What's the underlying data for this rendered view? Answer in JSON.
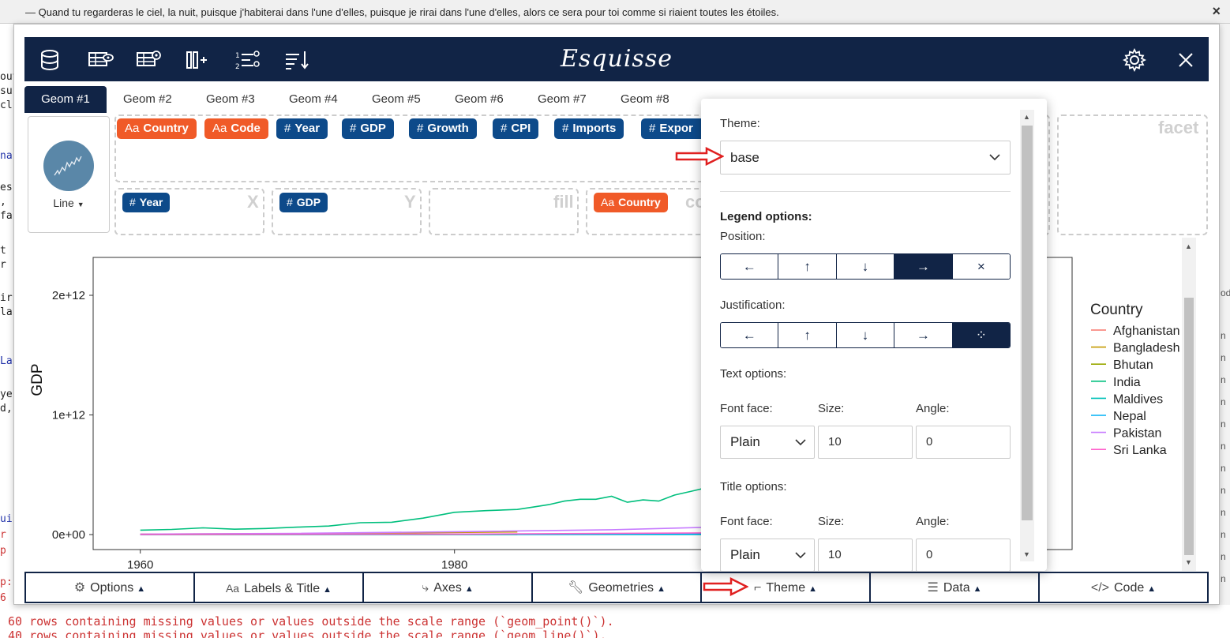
{
  "notification": {
    "message": "— Quand tu regarderas le ciel, la nuit, puisque j'habiterai dans l'une d'elles, puisque je rirai dans l'une d'elles, alors ce sera pour toi comme si riaient toutes les étoiles.",
    "close": "×"
  },
  "app": {
    "title": "Esquisse"
  },
  "tabs": [
    "Geom #1",
    "Geom #2",
    "Geom #3",
    "Geom #4",
    "Geom #5",
    "Geom #6",
    "Geom #7",
    "Geom #8"
  ],
  "geom": {
    "label": "Line"
  },
  "variables": [
    {
      "prefix": "Aa",
      "name": "Country",
      "type": "chr"
    },
    {
      "prefix": "Aa",
      "name": "Code",
      "type": "chr"
    },
    {
      "prefix": "#",
      "name": "Year",
      "type": "num"
    },
    {
      "prefix": "#",
      "name": "GDP",
      "type": "num"
    },
    {
      "prefix": "#",
      "name": "Growth",
      "type": "num"
    },
    {
      "prefix": "#",
      "name": "CPI",
      "type": "num"
    },
    {
      "prefix": "#",
      "name": "Imports",
      "type": "num"
    },
    {
      "prefix": "#",
      "name": "Expor",
      "type": "num"
    }
  ],
  "mappings": {
    "x": {
      "label": "X",
      "chip_prefix": "#",
      "chip": "Year"
    },
    "y": {
      "label": "Y",
      "chip_prefix": "#",
      "chip": "GDP"
    },
    "fill": {
      "label": "fill"
    },
    "color": {
      "label": "co",
      "chip_prefix": "Aa",
      "chip": "Country"
    },
    "facet": {
      "label": "facet"
    }
  },
  "theme_panel": {
    "theme_label": "Theme:",
    "theme_value": "base",
    "legend_heading": "Legend options:",
    "position_label": "Position:",
    "position_buttons": [
      "←",
      "↑",
      "↓",
      "→",
      "×"
    ],
    "position_selected": 3,
    "justification_label": "Justification:",
    "justification_buttons": [
      "←",
      "↑",
      "↓",
      "→",
      "⁘"
    ],
    "justification_selected": 4,
    "text_options_label": "Text options:",
    "font_face_label": "Font face:",
    "size_label": "Size:",
    "angle_label": "Angle:",
    "text_font_face": "Plain",
    "text_size": "10",
    "text_angle": "0",
    "title_options_label": "Title options:",
    "title_font_face": "Plain",
    "title_size": "10",
    "title_angle": "0"
  },
  "bottom_bar": [
    "Options",
    "Labels & Title",
    "Axes",
    "Geometries",
    "Theme",
    "Data",
    "Code"
  ],
  "chart_data": {
    "type": "line",
    "xlabel": "Year",
    "ylabel": "GDP",
    "x_ticks": [
      "1960",
      "1980"
    ],
    "y_ticks": [
      "0e+00",
      "1e+12",
      "2e+12"
    ],
    "legend_title": "Country",
    "legend_position": "right",
    "series": [
      {
        "name": "Afghanistan",
        "color": "#f8766d",
        "x": [
          1960,
          1970,
          1980,
          1984
        ],
        "y": [
          500000000.0,
          1000000000.0,
          3500000000.0,
          4000000000.0
        ]
      },
      {
        "name": "Bangladesh",
        "color": "#c49a00",
        "x": [
          1960,
          1970,
          1980,
          1984
        ],
        "y": [
          4000000000.0,
          8000000000.0,
          18000000000.0,
          22000000000.0
        ]
      },
      {
        "name": "Bhutan",
        "color": "#99a800",
        "x": [
          1960,
          1980,
          1984
        ],
        "y": [
          100000000.0,
          200000000.0,
          300000000.0
        ]
      },
      {
        "name": "India",
        "color": "#00bf7d",
        "x": [
          1960,
          1962,
          1964,
          1966,
          1968,
          1970,
          1972,
          1974,
          1976,
          1978,
          1980,
          1982,
          1984,
          1985,
          1986,
          1987,
          1988,
          1989,
          1990,
          1991,
          1992,
          1993,
          1994,
          1995,
          1996,
          1997,
          1998,
          1999,
          2000
        ],
        "y": [
          37000000000.0,
          43000000000.0,
          56000000000.0,
          45000000000.0,
          51000000000.0,
          62000000000.0,
          71000000000.0,
          99000000000.0,
          103000000000.0,
          137000000000.0,
          186000000000.0,
          200000000000.0,
          210000000000.0,
          230000000000.0,
          250000000000.0,
          280000000000.0,
          295000000000.0,
          295000000000.0,
          320000000000.0,
          270000000000.0,
          290000000000.0,
          280000000000.0,
          330000000000.0,
          360000000000.0,
          390000000000.0,
          415000000000.0,
          420000000000.0,
          460000000000.0,
          470000000000.0
        ]
      },
      {
        "name": "Maldives",
        "color": "#00c0b8",
        "x": [
          1960,
          1980,
          2000
        ],
        "y": [
          50000000.0,
          100000000.0,
          700000000.0
        ]
      },
      {
        "name": "Nepal",
        "color": "#00b0f6",
        "x": [
          1960,
          1980,
          2000
        ],
        "y": [
          500000000.0,
          1900000000.0,
          5500000000.0
        ]
      },
      {
        "name": "Pakistan",
        "color": "#c77cff",
        "x": [
          1960,
          1970,
          1980,
          1990,
          2000
        ],
        "y": [
          3700000000.0,
          10000000000.0,
          24000000000.0,
          40000000000.0,
          74000000000.0
        ]
      },
      {
        "name": "Sri Lanka",
        "color": "#ff61cc",
        "x": [
          1960,
          1980,
          2000
        ],
        "y": [
          1400000000.0,
          4000000000.0,
          16000000000.0
        ]
      }
    ],
    "xlim": [
      1957,
      2000
    ],
    "ylim": [
      -40000000000.0,
      2500000000000.0
    ]
  },
  "colors": {
    "navy": "#112446",
    "chip_num": "#0d4a8a",
    "chip_chr": "#f05a28",
    "annotation_arrow": "#e02020"
  }
}
